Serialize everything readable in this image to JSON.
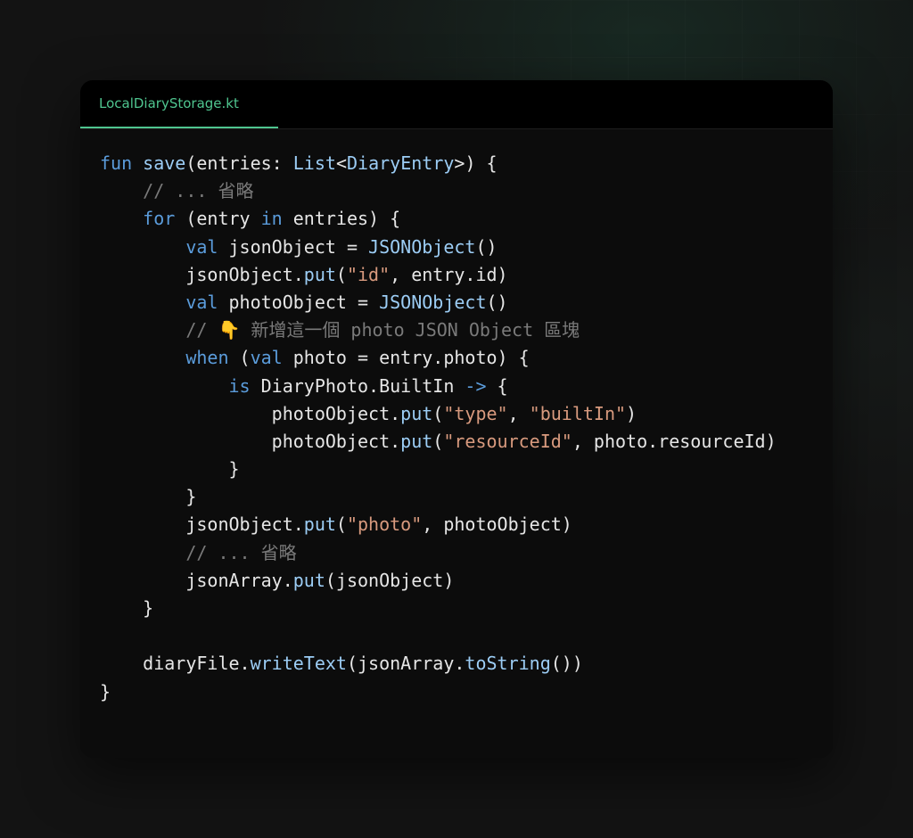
{
  "tab": {
    "filename": "LocalDiaryStorage.kt"
  },
  "colors": {
    "accent": "#4fc58f",
    "keyword": "#5b9cdb",
    "function": "#9ccdf5",
    "string": "#d89a7e",
    "comment": "#7a7a7a",
    "text": "#e6e6e6"
  },
  "code": {
    "lines": [
      [
        [
          "keyword",
          "fun"
        ],
        [
          "plain",
          " "
        ],
        [
          "function",
          "save"
        ],
        [
          "plain",
          "(entries: "
        ],
        [
          "type",
          "List"
        ],
        [
          "plain",
          "<"
        ],
        [
          "type",
          "DiaryEntry"
        ],
        [
          "plain",
          ">) {"
        ]
      ],
      [
        [
          "plain",
          "    "
        ],
        [
          "comment",
          "// ... 省略"
        ]
      ],
      [
        [
          "plain",
          "    "
        ],
        [
          "keyword",
          "for"
        ],
        [
          "plain",
          " (entry "
        ],
        [
          "keyword",
          "in"
        ],
        [
          "plain",
          " entries) {"
        ]
      ],
      [
        [
          "plain",
          "        "
        ],
        [
          "keyword",
          "val"
        ],
        [
          "plain",
          " jsonObject = "
        ],
        [
          "type",
          "JSONObject"
        ],
        [
          "plain",
          "()"
        ]
      ],
      [
        [
          "plain",
          "        jsonObject."
        ],
        [
          "function",
          "put"
        ],
        [
          "plain",
          "("
        ],
        [
          "string",
          "\"id\""
        ],
        [
          "plain",
          ", entry.id)"
        ]
      ],
      [
        [
          "plain",
          "        "
        ],
        [
          "keyword",
          "val"
        ],
        [
          "plain",
          " photoObject = "
        ],
        [
          "type",
          "JSONObject"
        ],
        [
          "plain",
          "()"
        ]
      ],
      [
        [
          "plain",
          "        "
        ],
        [
          "comment",
          "// 👇 新增這一個 photo JSON Object 區塊"
        ]
      ],
      [
        [
          "plain",
          "        "
        ],
        [
          "keyword",
          "when"
        ],
        [
          "plain",
          " ("
        ],
        [
          "keyword",
          "val"
        ],
        [
          "plain",
          " photo = entry.photo) {"
        ]
      ],
      [
        [
          "plain",
          "            "
        ],
        [
          "keyword",
          "is"
        ],
        [
          "plain",
          " DiaryPhoto.BuiltIn "
        ],
        [
          "operator",
          "->"
        ],
        [
          "plain",
          " {"
        ]
      ],
      [
        [
          "plain",
          "                photoObject."
        ],
        [
          "function",
          "put"
        ],
        [
          "plain",
          "("
        ],
        [
          "string",
          "\"type\""
        ],
        [
          "plain",
          ", "
        ],
        [
          "string",
          "\"builtIn\""
        ],
        [
          "plain",
          ")"
        ]
      ],
      [
        [
          "plain",
          "                photoObject."
        ],
        [
          "function",
          "put"
        ],
        [
          "plain",
          "("
        ],
        [
          "string",
          "\"resourceId\""
        ],
        [
          "plain",
          ", photo.resourceId)"
        ]
      ],
      [
        [
          "plain",
          "            }"
        ]
      ],
      [
        [
          "plain",
          "        }"
        ]
      ],
      [
        [
          "plain",
          "        jsonObject."
        ],
        [
          "function",
          "put"
        ],
        [
          "plain",
          "("
        ],
        [
          "string",
          "\"photo\""
        ],
        [
          "plain",
          ", photoObject)"
        ]
      ],
      [
        [
          "plain",
          "        "
        ],
        [
          "comment",
          "// ... 省略"
        ]
      ],
      [
        [
          "plain",
          "        jsonArray."
        ],
        [
          "function",
          "put"
        ],
        [
          "plain",
          "(jsonObject)"
        ]
      ],
      [
        [
          "plain",
          "    }"
        ]
      ],
      [
        [
          "plain",
          ""
        ]
      ],
      [
        [
          "plain",
          "    diaryFile."
        ],
        [
          "function",
          "writeText"
        ],
        [
          "plain",
          "(jsonArray."
        ],
        [
          "function",
          "toString"
        ],
        [
          "plain",
          "())"
        ]
      ],
      [
        [
          "plain",
          "}"
        ]
      ]
    ]
  }
}
